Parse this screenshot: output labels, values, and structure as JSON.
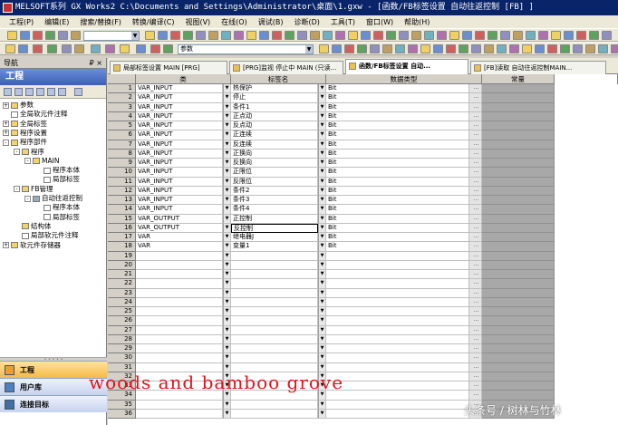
{
  "window": {
    "title": "MELSOFT系列 GX Works2 C:\\Documents and Settings\\Administrator\\桌面\\1.gxw - [函数/FB标签设置 自动往返控制 [FB] ]"
  },
  "menu": [
    "工程(P)",
    "编辑(E)",
    "搜索/替换(F)",
    "转换/编译(C)",
    "视图(V)",
    "在线(O)",
    "调试(B)",
    "诊断(D)",
    "工具(T)",
    "窗口(W)",
    "帮助(H)"
  ],
  "toolbar": {
    "combo_label": "参数"
  },
  "navigation": {
    "header": "导航",
    "pin": "₽ ×",
    "section_title": "工程",
    "tree": [
      {
        "label": "参数",
        "level": 0,
        "exp": "+",
        "icon": "folder"
      },
      {
        "label": "全局软元件注释",
        "level": 0,
        "exp": "",
        "icon": "doc"
      },
      {
        "label": "全局标签",
        "level": 0,
        "exp": "+",
        "icon": "folder"
      },
      {
        "label": "程序设置",
        "level": 0,
        "exp": "+",
        "icon": "folder"
      },
      {
        "label": "程序部件",
        "level": 0,
        "exp": "-",
        "icon": "folder"
      },
      {
        "label": "程序",
        "level": 1,
        "exp": "-",
        "icon": "folder"
      },
      {
        "label": "MAIN",
        "level": 2,
        "exp": "-",
        "icon": "folder"
      },
      {
        "label": "程序本体",
        "level": 3,
        "exp": "",
        "icon": "doc"
      },
      {
        "label": "局部标签",
        "level": 3,
        "exp": "",
        "icon": "doc"
      },
      {
        "label": "FB管理",
        "level": 1,
        "exp": "-",
        "icon": "folder"
      },
      {
        "label": "自动往返控制",
        "level": 2,
        "exp": "-",
        "icon": "gear"
      },
      {
        "label": "程序本体",
        "level": 3,
        "exp": "",
        "icon": "doc"
      },
      {
        "label": "局部标签",
        "level": 3,
        "exp": "",
        "icon": "doc"
      },
      {
        "label": "结构体",
        "level": 1,
        "exp": "",
        "icon": "folder"
      },
      {
        "label": "局部软元件注释",
        "level": 1,
        "exp": "",
        "icon": "doc"
      },
      {
        "label": "软元件存储器",
        "level": 0,
        "exp": "+",
        "icon": "folder"
      }
    ],
    "bottom_buttons": [
      "工程",
      "用户库",
      "连接目标"
    ]
  },
  "tabs": [
    "局部标签设置 MAIN [PRG]",
    "[PRG]监视 停止中 MAIN (只读...",
    "函数/FB标签设置 自动...",
    "[FB]读取 自动往返控制MAIN..."
  ],
  "active_tab_index": 2,
  "grid": {
    "columns": [
      "类",
      "标签名",
      "数据类型",
      "常量"
    ],
    "rows": [
      {
        "no": "1",
        "class": "VAR_INPUT",
        "label": "热保护",
        "type": "Bit"
      },
      {
        "no": "2",
        "class": "VAR_INPUT",
        "label": "停止",
        "type": "Bit"
      },
      {
        "no": "3",
        "class": "VAR_INPUT",
        "label": "条件1",
        "type": "Bit"
      },
      {
        "no": "4",
        "class": "VAR_INPUT",
        "label": "正点动",
        "type": "Bit"
      },
      {
        "no": "5",
        "class": "VAR_INPUT",
        "label": "反点动",
        "type": "Bit"
      },
      {
        "no": "6",
        "class": "VAR_INPUT",
        "label": "正连续",
        "type": "Bit"
      },
      {
        "no": "7",
        "class": "VAR_INPUT",
        "label": "反连续",
        "type": "Bit"
      },
      {
        "no": "8",
        "class": "VAR_INPUT",
        "label": "正换向",
        "type": "Bit"
      },
      {
        "no": "9",
        "class": "VAR_INPUT",
        "label": "反换向",
        "type": "Bit"
      },
      {
        "no": "10",
        "class": "VAR_INPUT",
        "label": "正限位",
        "type": "Bit"
      },
      {
        "no": "11",
        "class": "VAR_INPUT",
        "label": "反限位",
        "type": "Bit"
      },
      {
        "no": "12",
        "class": "VAR_INPUT",
        "label": "条件2",
        "type": "Bit"
      },
      {
        "no": "13",
        "class": "VAR_INPUT",
        "label": "条件3",
        "type": "Bit"
      },
      {
        "no": "14",
        "class": "VAR_INPUT",
        "label": "条件4",
        "type": "Bit"
      },
      {
        "no": "15",
        "class": "VAR_OUTPUT",
        "label": "正控制",
        "type": "Bit"
      },
      {
        "no": "16",
        "class": "VAR_OUTPUT",
        "label": "反控制",
        "type": "Bit"
      },
      {
        "no": "17",
        "class": "VAR",
        "label": "继电器J",
        "type": "Bit"
      },
      {
        "no": "18",
        "class": "VAR",
        "label": "变量1",
        "type": "Bit"
      },
      {
        "no": "19",
        "class": "",
        "label": "",
        "type": ""
      },
      {
        "no": "20",
        "class": "",
        "label": "",
        "type": ""
      },
      {
        "no": "21",
        "class": "",
        "label": "",
        "type": ""
      },
      {
        "no": "22",
        "class": "",
        "label": "",
        "type": ""
      },
      {
        "no": "23",
        "class": "",
        "label": "",
        "type": ""
      },
      {
        "no": "24",
        "class": "",
        "label": "",
        "type": ""
      },
      {
        "no": "25",
        "class": "",
        "label": "",
        "type": ""
      },
      {
        "no": "26",
        "class": "",
        "label": "",
        "type": ""
      },
      {
        "no": "27",
        "class": "",
        "label": "",
        "type": ""
      },
      {
        "no": "28",
        "class": "",
        "label": "",
        "type": ""
      },
      {
        "no": "29",
        "class": "",
        "label": "",
        "type": ""
      },
      {
        "no": "30",
        "class": "",
        "label": "",
        "type": ""
      },
      {
        "no": "31",
        "class": "",
        "label": "",
        "type": ""
      },
      {
        "no": "32",
        "class": "",
        "label": "",
        "type": ""
      },
      {
        "no": "33",
        "class": "",
        "label": "",
        "type": ""
      },
      {
        "no": "34",
        "class": "",
        "label": "",
        "type": ""
      },
      {
        "no": "35",
        "class": "",
        "label": "",
        "type": ""
      },
      {
        "no": "36",
        "class": "",
        "label": "",
        "type": ""
      }
    ]
  },
  "overlay": {
    "watermark": "woods and bamboo grove",
    "credit": "头条号 / 树林与竹林"
  },
  "colors": {
    "title_bar": "#0a246a",
    "watermark": "#e0141e",
    "constant_column": "#a8a8a8"
  }
}
